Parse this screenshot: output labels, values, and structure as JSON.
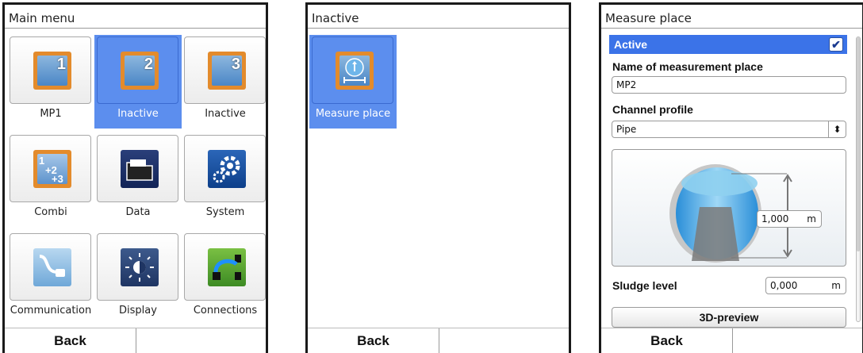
{
  "screen1": {
    "title": "Main menu",
    "tiles": [
      {
        "label": "MP1",
        "icon": "measurement-place-1-icon",
        "badge": "1"
      },
      {
        "label": "Inactive",
        "icon": "measurement-place-2-icon",
        "badge": "2",
        "selected": true
      },
      {
        "label": "Inactive",
        "icon": "measurement-place-3-icon",
        "badge": "3"
      },
      {
        "label": "Combi",
        "icon": "combi-icon"
      },
      {
        "label": "Data",
        "icon": "data-folder-icon"
      },
      {
        "label": "System",
        "icon": "system-gear-icon"
      },
      {
        "label": "Communication",
        "icon": "communication-icon"
      },
      {
        "label": "Display",
        "icon": "display-brightness-icon"
      },
      {
        "label": "Connections",
        "icon": "connections-icon"
      }
    ],
    "back_label": "Back"
  },
  "screen2": {
    "title": "Inactive",
    "tiles": [
      {
        "label": "Measure place",
        "icon": "measure-place-icon",
        "selected": true
      }
    ],
    "back_label": "Back"
  },
  "screen3": {
    "title": "Measure place",
    "active_label": "Active",
    "active_checked": true,
    "name_label": "Name of measurement place",
    "name_value": "MP2",
    "profile_label": "Channel profile",
    "profile_value": "Pipe",
    "diameter_value": "1,000",
    "diameter_unit": "m",
    "sludge_label": "Sludge level",
    "sludge_value": "0,000",
    "sludge_unit": "m",
    "preview_button": "3D-preview",
    "back_label": "Back"
  },
  "colors": {
    "selection": "#5c8eee",
    "active_row": "#3b73e8",
    "icon_orange": "#e38b2c"
  }
}
